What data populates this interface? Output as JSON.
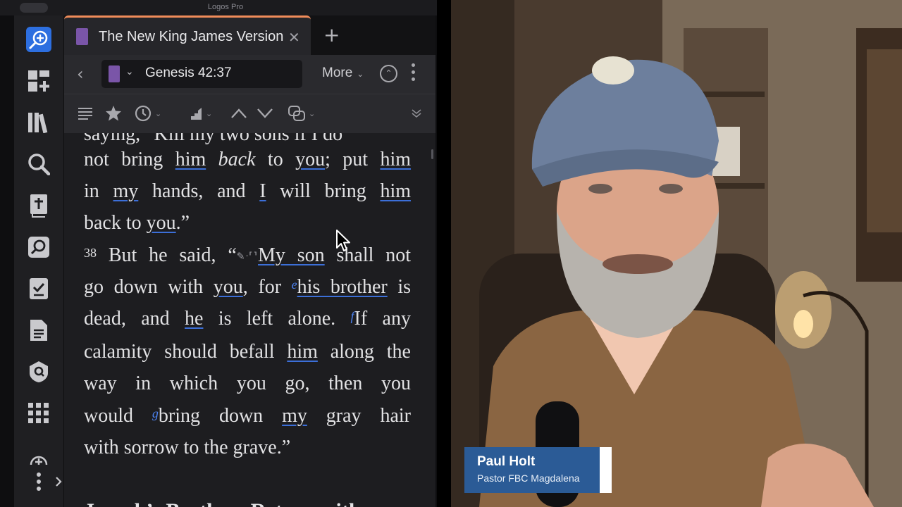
{
  "window": {
    "title": "Logos Pro"
  },
  "tab": {
    "title": "The New King James Version",
    "close_glyph": "✕",
    "add_glyph": "+"
  },
  "nav": {
    "back_glyph": "‹",
    "reference": "Genesis 42:37",
    "more_label": "More"
  },
  "sidebar": {
    "icons": [
      "search-plus-icon",
      "dashboard-add-icon",
      "library-icon",
      "search-icon",
      "bible-icon",
      "bible-search-icon",
      "checklist-icon",
      "document-icon",
      "shield-icon",
      "apps-grid-icon",
      "more-vert-icon"
    ]
  },
  "toolbar": {
    "icons": [
      "panel-menu-icon",
      "favorite-star-icon",
      "history-icon",
      "visual-filter-icon",
      "previous-icon",
      "next-icon",
      "link-sets-icon",
      "collapse-icon"
    ]
  },
  "text": {
    "cut_line": "saying, “Kill my two sons if I do",
    "l1": {
      "a": "not bring ",
      "b": "him",
      "c": " ",
      "d": "back",
      "e": " to ",
      "f": "you",
      "g": "; put ",
      "h": "him"
    },
    "l2": {
      "a": "in ",
      "b": "my",
      "c": " hands, and ",
      "d": "I",
      "e": " will bring ",
      "f": "him"
    },
    "l3": {
      "a": "back to ",
      "b": "you",
      "c": ".”"
    },
    "l4": {
      "vnum": "38",
      "a": "But he said, “",
      "marks": "✎ᐧ⸢⸣",
      "b": "My son",
      "c": " ",
      "d": "shall",
      "e": " not"
    },
    "l5": {
      "a": "go down with ",
      "b": "you",
      "c": ", for ",
      "sup": "e",
      "d": "his brother",
      "e": " is"
    },
    "l6": {
      "a": "dead, and ",
      "b": "he",
      "c": " is left alone. ",
      "sup": "f",
      "d": "If any"
    },
    "l7": {
      "a": "calamity should befall ",
      "b": "him",
      "c": " along the"
    },
    "l8": {
      "a": "way in which you go, then you"
    },
    "l9": {
      "a": "would ",
      "sup": "g",
      "b": "bring down ",
      "c": "my",
      "d": " gray hair"
    },
    "l10": {
      "a": "with sorrow to the grave.”"
    },
    "next_heading": "Joseph’s Brothers Return with"
  },
  "lower_third": {
    "name": "Paul Holt",
    "role": "Pastor FBC Magdalena"
  },
  "colors": {
    "accent_tab": "#f08c5a",
    "link_underline": "#3c6fd8",
    "lower_third_bg": "#2b5b96",
    "book_icon": "#7a55a8"
  }
}
